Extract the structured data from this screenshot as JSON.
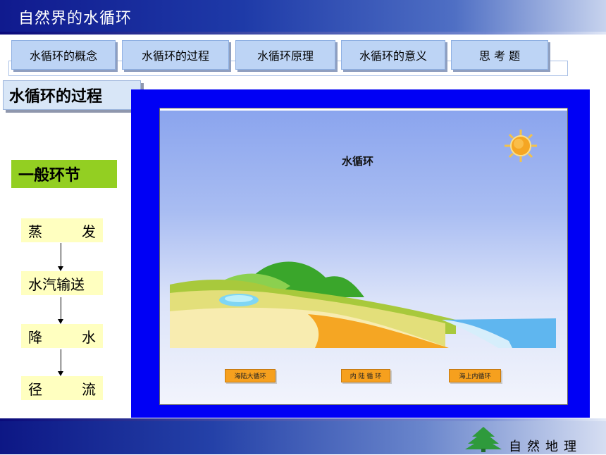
{
  "header": {
    "title": "自然界的水循环"
  },
  "nav": {
    "tabs": [
      {
        "label": "水循环的概念"
      },
      {
        "label": "水循环的过程"
      },
      {
        "label": "水循环原理"
      },
      {
        "label": "水循环的意义"
      },
      {
        "label": "思 考 题"
      }
    ]
  },
  "section": {
    "title": "水循环的过程"
  },
  "sidebar": {
    "heading": "一般环节",
    "steps": [
      {
        "a": "蒸",
        "b": "发"
      },
      {
        "text": "水汽输送"
      },
      {
        "a": "降",
        "b": "水"
      },
      {
        "a": "径",
        "b": "流"
      }
    ]
  },
  "animation": {
    "title": "水循环",
    "buttons": [
      {
        "label": "海陆大循环"
      },
      {
        "label": "内 陆 循 环"
      },
      {
        "label": "海上内循环"
      }
    ]
  },
  "colors": {
    "title_bar": "#1e3aa8",
    "frame": "#0000f5",
    "tab_bg": "#bdd4f5",
    "heading_bg": "#93cf22",
    "step_bg": "#ffffc0",
    "button_bg": "#f6a01e"
  },
  "footer": {
    "brand": "自然地理",
    "logo_icon": "pine-tree-icon"
  }
}
